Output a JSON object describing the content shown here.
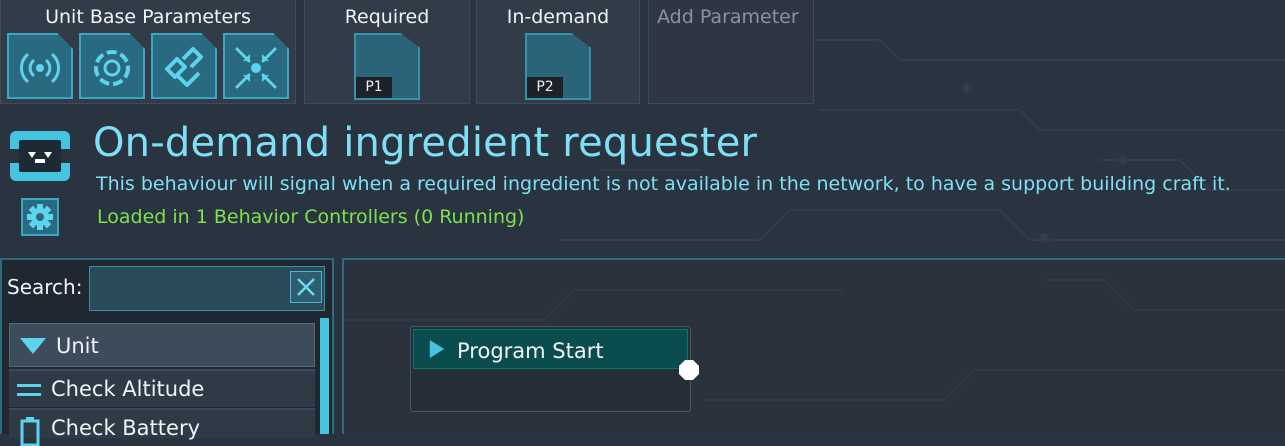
{
  "tabs": [
    {
      "title": "Unit Base Parameters",
      "icons": [
        "radar-signal-icon",
        "swirl-icon",
        "chain-link-icon",
        "converge-arrows-icon"
      ]
    },
    {
      "title": "Required",
      "param_label": "P1"
    },
    {
      "title": "In-demand",
      "param_label": "P2"
    },
    {
      "title": "Add Parameter"
    }
  ],
  "header": {
    "title": "On-demand ingredient requester",
    "description": "This behaviour will signal when a required ingredient is not available in the network, to have a support building craft it.",
    "status": "Loaded in 1 Behavior Controllers (0 Running)"
  },
  "library": {
    "search_label": "Search:",
    "search_value": "",
    "category": "Unit",
    "items": [
      "Check Altitude",
      "Check Battery"
    ]
  },
  "graph": {
    "nodes": [
      {
        "label": "Program Start"
      }
    ]
  },
  "colors": {
    "accent": "#45c4e0",
    "title_text": "#7fdff5",
    "status_text": "#7de24e",
    "background": "#2a3340",
    "node_header": "#0b4d4f"
  }
}
